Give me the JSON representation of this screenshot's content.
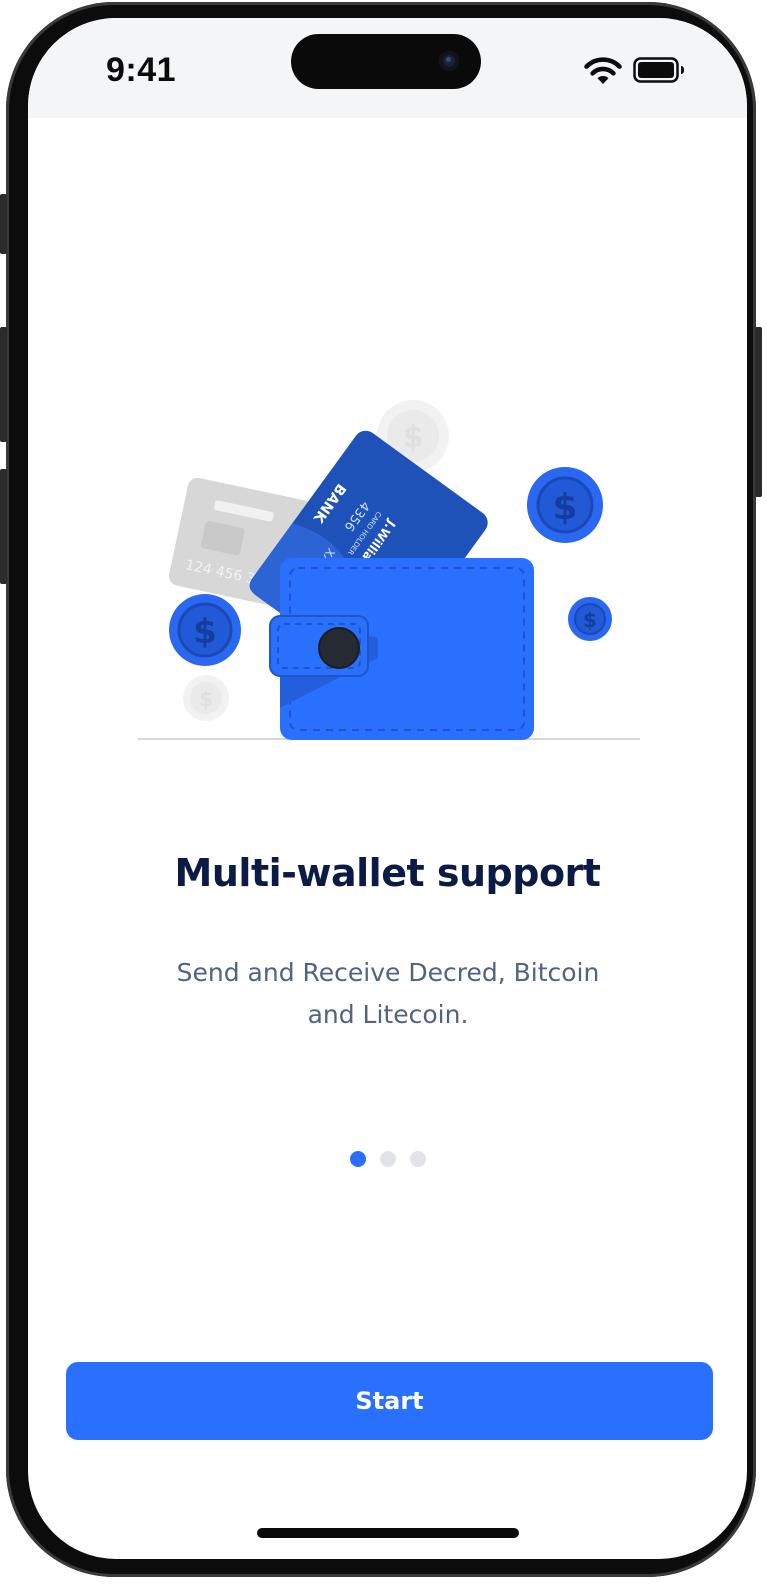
{
  "status_bar": {
    "time": "9:41",
    "wifi_icon": "wifi-icon",
    "battery_icon": "battery-icon"
  },
  "illustration": {
    "icon": "wallet-illustration",
    "card_bank_label": "BANK",
    "card_number_fragment": "4356",
    "card_masked": "XXX",
    "card_holder": "J.Williams",
    "card_holder_caption": "CARD HOLDER",
    "back_card_number": "124 456 3",
    "coin_symbol": "$"
  },
  "onboarding": {
    "title": "Multi-wallet support",
    "subtitle": "Send and Receive Decred, Bitcoin and Litecoin.",
    "page_indicator": {
      "total": 3,
      "active": 1
    }
  },
  "actions": {
    "start_label": "Start"
  },
  "colors": {
    "accent": "#2970ff",
    "title": "#0c1b45",
    "subtitle": "#516380"
  }
}
